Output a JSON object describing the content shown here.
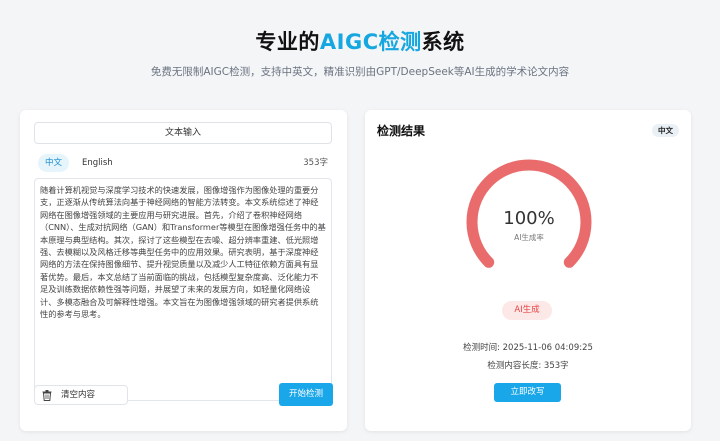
{
  "header": {
    "title_prefix": "专业的",
    "title_accent": "AIGC检测",
    "title_suffix": "系统",
    "subtitle": "免费无限制AIGC检测，支持中英文，精准识别由GPT/DeepSeek等AI生成的学术论文内容"
  },
  "input_panel": {
    "header_label": "文本输入",
    "tabs": [
      {
        "label": "中文",
        "active": true
      },
      {
        "label": "English",
        "active": false
      }
    ],
    "char_count": "353字",
    "text": "随着计算机视觉与深度学习技术的快速发展，图像增强作为图像处理的重要分支，正逐渐从传统算法向基于神经网络的智能方法转变。本文系统综述了神经网络在图像增强领域的主要应用与研究进展。首先，介绍了卷积神经网络（CNN）、生成对抗网络（GAN）和Transformer等模型在图像增强任务中的基本原理与典型结构。其次，探讨了这些模型在去噪、超分辨率重建、低光照增强、去模糊以及风格迁移等典型任务中的应用效果。研究表明，基于深度神经网络的方法在保持图像细节、提升视觉质量以及减少人工特征依赖方面具有显著优势。最后，本文总结了当前面临的挑战，包括模型复杂度高、泛化能力不足及训练数据依赖性强等问题，并展望了未来的发展方向，如轻量化网络设计、多模态融合及可解释性增强。本文旨在为图像增强领域的研究者提供系统性的参考与思考。",
    "clear_label": "清空内容",
    "start_label": "开始检测"
  },
  "result_panel": {
    "title": "检测结果",
    "lang_badge": "中文",
    "percent": "100%",
    "percent_value": 100,
    "gauge_label": "AI生成率",
    "verdict": "AI生成",
    "time_label": "检测时间: 2025-11-06 04:09:25",
    "length_label": "检测内容长度: 353字",
    "rewrite_label": "立即改写"
  },
  "colors": {
    "accent": "#17a7e0",
    "button": "#1aa7ea",
    "gauge": "#ea6b6b",
    "verdict_text": "#e74646",
    "verdict_bg": "#fde8e8"
  }
}
